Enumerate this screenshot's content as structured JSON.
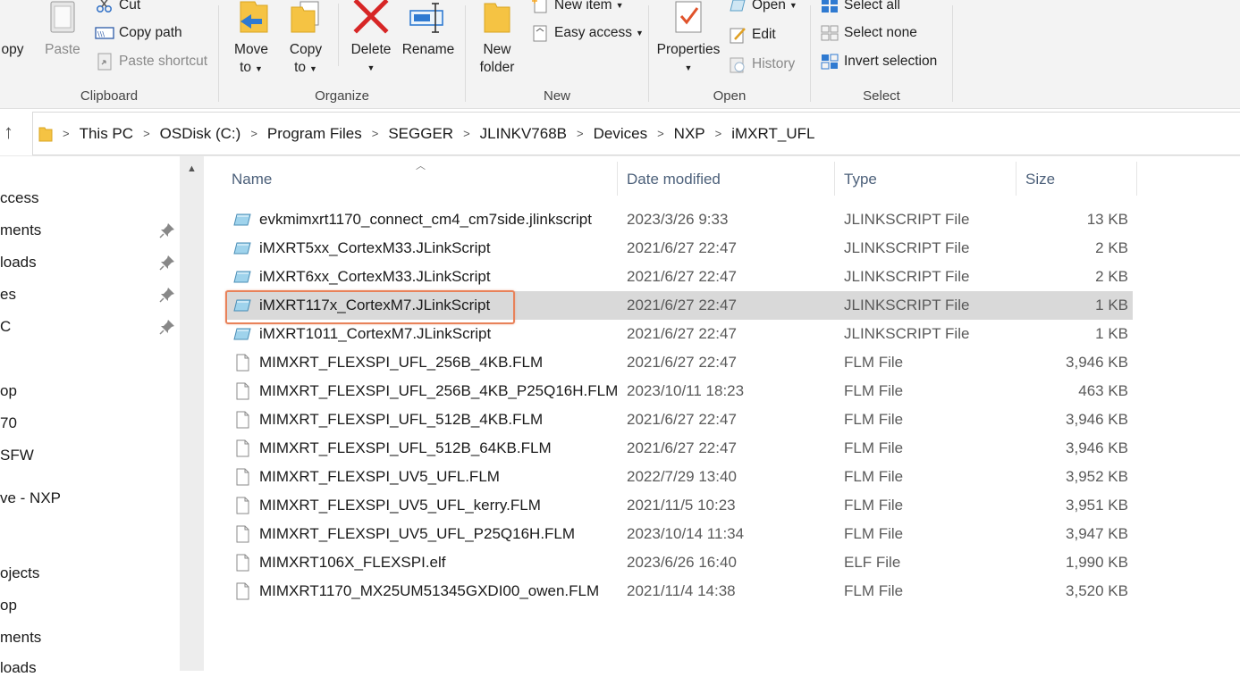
{
  "ribbon": {
    "clipboard": {
      "label": "Clipboard",
      "copy_label": "opy",
      "paste_label": "Paste",
      "cut_label": "Cut",
      "copy_path_label": "Copy path",
      "paste_shortcut_label": "Paste shortcut"
    },
    "organize": {
      "label": "Organize",
      "move_to_line1": "Move",
      "move_to_line2": "to",
      "copy_to_line1": "Copy",
      "copy_to_line2": "to",
      "delete_label": "Delete",
      "rename_label": "Rename"
    },
    "new": {
      "label": "New",
      "new_folder_line1": "New",
      "new_folder_line2": "folder",
      "new_item_label": "New item",
      "easy_access_label": "Easy access"
    },
    "open": {
      "label": "Open",
      "properties_label": "Properties",
      "open_label": "Open",
      "edit_label": "Edit",
      "history_label": "History"
    },
    "select": {
      "label": "Select",
      "select_all_label": "Select all",
      "select_none_label": "Select none",
      "invert_selection_label": "Invert selection"
    }
  },
  "address": {
    "crumbs": [
      "This PC",
      "OSDisk (C:)",
      "Program Files",
      "SEGGER",
      "JLINKV768B",
      "Devices",
      "NXP",
      "iMXRT_UFL"
    ]
  },
  "nav": {
    "items": [
      {
        "label": "ccess",
        "pinned": false
      },
      {
        "label": "ments",
        "pinned": true
      },
      {
        "label": "loads",
        "pinned": true
      },
      {
        "label": "es",
        "pinned": true
      },
      {
        "label": "C",
        "pinned": true
      },
      {
        "label": "op",
        "pinned": false
      },
      {
        "label": "70",
        "pinned": false
      },
      {
        "label": "SFW",
        "pinned": false
      },
      {
        "label": "ve - NXP",
        "pinned": false
      },
      {
        "label": "ojects",
        "pinned": false
      },
      {
        "label": "op",
        "pinned": false
      },
      {
        "label": "ments",
        "pinned": false
      },
      {
        "label": "loads",
        "pinned": false
      }
    ]
  },
  "columns": {
    "name": "Name",
    "date": "Date modified",
    "type": "Type",
    "size": "Size"
  },
  "files": [
    {
      "name": "evkmimxrt1170_connect_cm4_cm7side.jlinkscript",
      "date": "2023/3/26 9:33",
      "type": "JLINKSCRIPT File",
      "size": "13 KB",
      "icon": "script-icon"
    },
    {
      "name": "iMXRT5xx_CortexM33.JLinkScript",
      "date": "2021/6/27 22:47",
      "type": "JLINKSCRIPT File",
      "size": "2 KB",
      "icon": "script-icon"
    },
    {
      "name": "iMXRT6xx_CortexM33.JLinkScript",
      "date": "2021/6/27 22:47",
      "type": "JLINKSCRIPT File",
      "size": "2 KB",
      "icon": "script-icon"
    },
    {
      "name": "iMXRT117x_CortexM7.JLinkScript",
      "date": "2021/6/27 22:47",
      "type": "JLINKSCRIPT File",
      "size": "1 KB",
      "icon": "script-icon",
      "selected": true
    },
    {
      "name": "iMXRT1011_CortexM7.JLinkScript",
      "date": "2021/6/27 22:47",
      "type": "JLINKSCRIPT File",
      "size": "1 KB",
      "icon": "script-icon"
    },
    {
      "name": "MIMXRT_FLEXSPI_UFL_256B_4KB.FLM",
      "date": "2021/6/27 22:47",
      "type": "FLM File",
      "size": "3,946 KB",
      "icon": "file-icon"
    },
    {
      "name": "MIMXRT_FLEXSPI_UFL_256B_4KB_P25Q16H.FLM",
      "date": "2023/10/11 18:23",
      "type": "FLM File",
      "size": "463 KB",
      "icon": "file-icon"
    },
    {
      "name": "MIMXRT_FLEXSPI_UFL_512B_4KB.FLM",
      "date": "2021/6/27 22:47",
      "type": "FLM File",
      "size": "3,946 KB",
      "icon": "file-icon"
    },
    {
      "name": "MIMXRT_FLEXSPI_UFL_512B_64KB.FLM",
      "date": "2021/6/27 22:47",
      "type": "FLM File",
      "size": "3,946 KB",
      "icon": "file-icon"
    },
    {
      "name": "MIMXRT_FLEXSPI_UV5_UFL.FLM",
      "date": "2022/7/29 13:40",
      "type": "FLM File",
      "size": "3,952 KB",
      "icon": "file-icon"
    },
    {
      "name": "MIMXRT_FLEXSPI_UV5_UFL_kerry.FLM",
      "date": "2021/11/5 10:23",
      "type": "FLM File",
      "size": "3,951 KB",
      "icon": "file-icon"
    },
    {
      "name": "MIMXRT_FLEXSPI_UV5_UFL_P25Q16H.FLM",
      "date": "2023/10/14 11:34",
      "type": "FLM File",
      "size": "3,947 KB",
      "icon": "file-icon"
    },
    {
      "name": "MIMXRT106X_FLEXSPI.elf",
      "date": "2023/6/26 16:40",
      "type": "ELF File",
      "size": "1,990 KB",
      "icon": "file-icon"
    },
    {
      "name": "MIMXRT1170_MX25UM51345GXDI00_owen.FLM",
      "date": "2021/11/4 14:38",
      "type": "FLM File",
      "size": "3,520 KB",
      "icon": "file-icon"
    }
  ],
  "colors": {
    "selection_bg": "#d9d9d9",
    "highlight_border": "#e8825a",
    "ribbon_bg": "#f3f3f3",
    "header_text": "#4c607a"
  }
}
